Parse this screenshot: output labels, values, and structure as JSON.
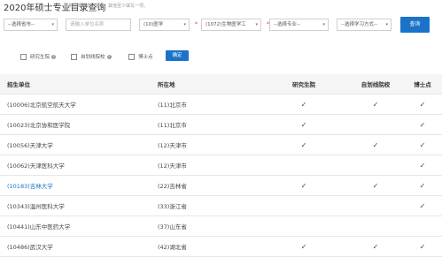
{
  "page": {
    "title": "2020年硕士专业目录查询",
    "hint": "学科类别为必选项，其他至少填写一项。"
  },
  "filters": {
    "province": "--选择省市--",
    "institution_placeholder": "请输入单位名称",
    "category": "(10)医学",
    "discipline": "(1072)生物医学工",
    "major": "--选择专业--",
    "study_mode": "--选择学习方式--",
    "query_button": "查询"
  },
  "options": {
    "graduate_school": "研究生院",
    "self_drawn": "自划线院校",
    "doctoral": "博士点",
    "confirm_button": "确定"
  },
  "table": {
    "headers": [
      "招生单位",
      "所在地",
      "研究生院",
      "自划线院校",
      "博士点"
    ],
    "check_mark": "✓",
    "rows": [
      {
        "unit": "(10006)北京航空航天大学",
        "location": "(11)北京市",
        "graduate_school": true,
        "self_drawn": true,
        "doctoral": true
      },
      {
        "unit": "(10023)北京协和医学院",
        "location": "(11)北京市",
        "graduate_school": true,
        "self_drawn": false,
        "doctoral": true
      },
      {
        "unit": "(10056)天津大学",
        "location": "(12)天津市",
        "graduate_school": true,
        "self_drawn": true,
        "doctoral": true
      },
      {
        "unit": "(10062)天津医科大学",
        "location": "(12)天津市",
        "graduate_school": false,
        "self_drawn": false,
        "doctoral": true
      },
      {
        "unit": "(10183)吉林大学",
        "location": "(22)吉林省",
        "graduate_school": true,
        "self_drawn": true,
        "doctoral": true
      },
      {
        "unit": "(10343)温州医科大学",
        "location": "(33)浙江省",
        "graduate_school": false,
        "self_drawn": false,
        "doctoral": true
      },
      {
        "unit": "(10441)山东中医药大学",
        "location": "(37)山东省",
        "graduate_school": false,
        "self_drawn": false,
        "doctoral": false
      },
      {
        "unit": "(10486)武汉大学",
        "location": "(42)湖北省",
        "graduate_school": true,
        "self_drawn": true,
        "doctoral": true
      }
    ]
  }
}
